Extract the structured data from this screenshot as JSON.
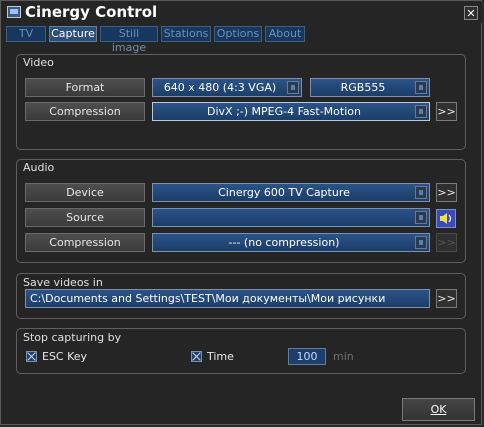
{
  "window": {
    "title": "Cinergy Control",
    "close_label": "✕"
  },
  "tabs": [
    {
      "label": "TV"
    },
    {
      "label": "Capture"
    },
    {
      "label": "Still image"
    },
    {
      "label": "Stations"
    },
    {
      "label": "Options"
    },
    {
      "label": "About"
    }
  ],
  "video": {
    "group_label": "Video",
    "format_label": "Format",
    "format_value": "640 x 480 (4:3 VGA)",
    "colorspace_value": "RGB555",
    "compression_label": "Compression",
    "compression_value": "DivX ;-) MPEG-4 Fast-Motion",
    "settings_label": ">>"
  },
  "audio": {
    "group_label": "Audio",
    "device_label": "Device",
    "device_value": "Cinergy 600 TV Capture",
    "device_settings_label": ">>",
    "source_label": "Source",
    "source_value": "",
    "compression_label": "Compression",
    "compression_value": "--- (no compression)",
    "compression_settings_label": ">>"
  },
  "save": {
    "group_label": "Save videos in",
    "path_value": "C:\\Documents and Settings\\TEST\\Мои документы\\Мои рисунки",
    "browse_label": ">>"
  },
  "stop": {
    "group_label": "Stop capturing by",
    "esc_label": "ESC Key",
    "esc_checked": true,
    "time_label": "Time",
    "time_checked": true,
    "time_value": "100",
    "time_unit": "min"
  },
  "footer": {
    "ok_label": "OK"
  },
  "colors": {
    "accent_blue": "#1b3e6a",
    "tab_active": "#2c4f78",
    "background": "#252525"
  }
}
